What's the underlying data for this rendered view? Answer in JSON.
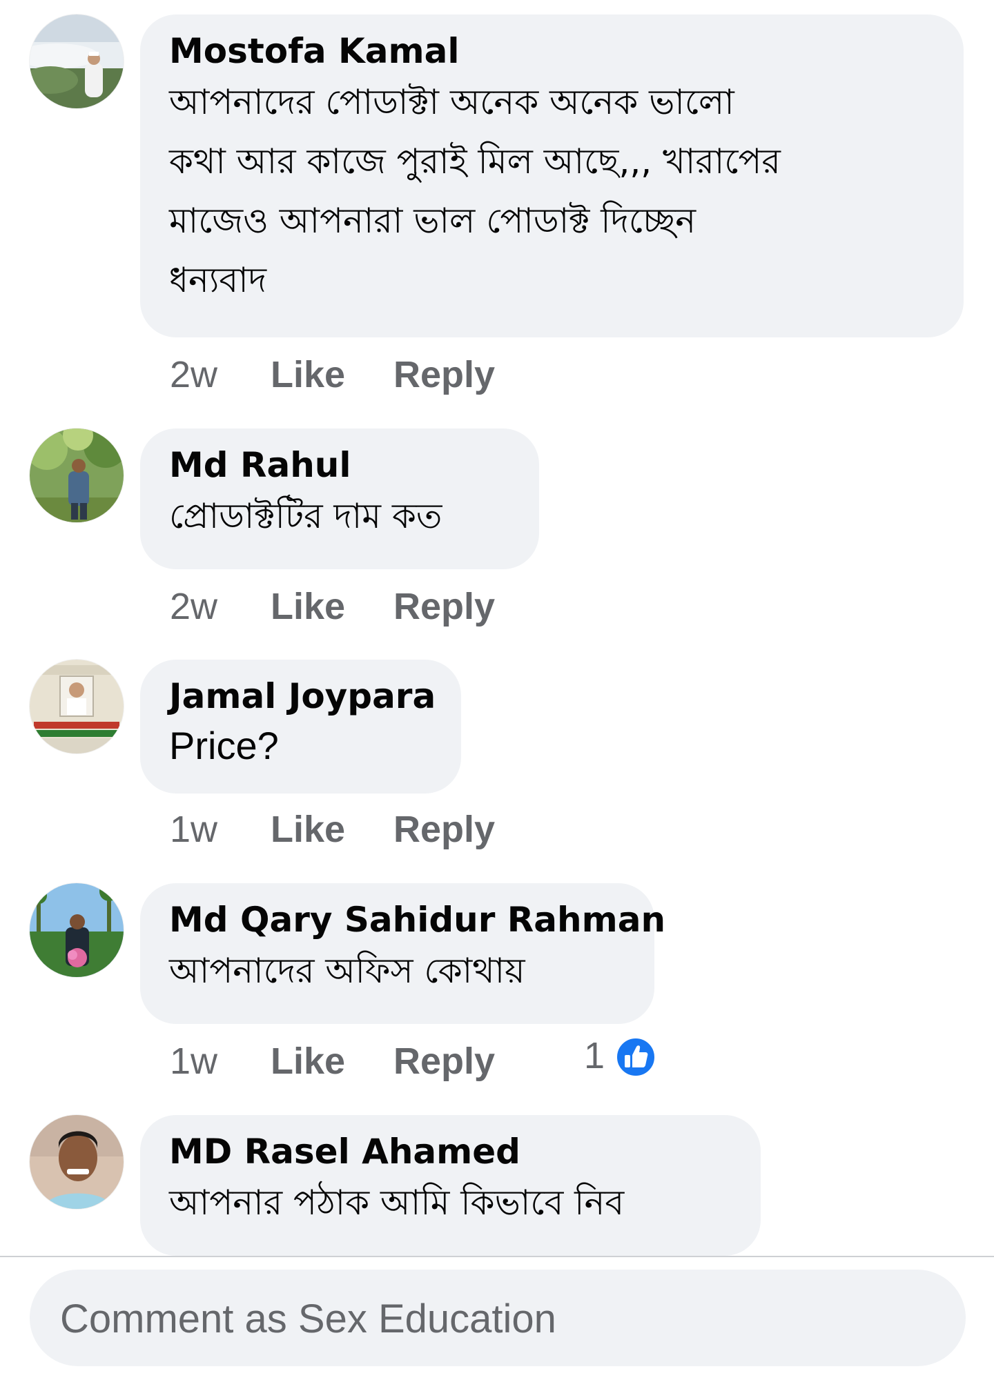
{
  "comments": [
    {
      "author": "Mostofa Kamal",
      "lines": [
        "আপনাদের পোডাক্টা অনেক অনেক ভালো",
        "কথা আর কাজে পুরাই মিল আছে,,, খারাপের",
        "মাজেও আপনারা ভাল পোডাক্ট দিচ্ছেন",
        "ধন্যবাদ"
      ],
      "time": "2w",
      "like_label": "Like",
      "reply_label": "Reply"
    },
    {
      "author": "Md Rahul",
      "lines": [
        "প্রোডাক্টটির দাম কত"
      ],
      "time": "2w",
      "like_label": "Like",
      "reply_label": "Reply"
    },
    {
      "author": "Jamal Joypara",
      "lines": [
        "Price?"
      ],
      "time": "1w",
      "like_label": "Like",
      "reply_label": "Reply"
    },
    {
      "author": "Md Qary Sahidur Rahman",
      "lines": [
        "আপনাদের অফিস কোথায়"
      ],
      "time": "1w",
      "like_label": "Like",
      "reply_label": "Reply",
      "reaction_count": "1",
      "reaction_icon": "thumbs-up-icon"
    },
    {
      "author": "MD Rasel Ahamed",
      "lines": [
        "আপনার পঠাক আমি কিভাবে নিব"
      ]
    }
  ],
  "composer": {
    "placeholder": "Comment as Sex Education"
  },
  "colors": {
    "bubble_bg": "#f0f2f5",
    "meta_text": "#65676b",
    "like_blue": "#1877f2"
  }
}
